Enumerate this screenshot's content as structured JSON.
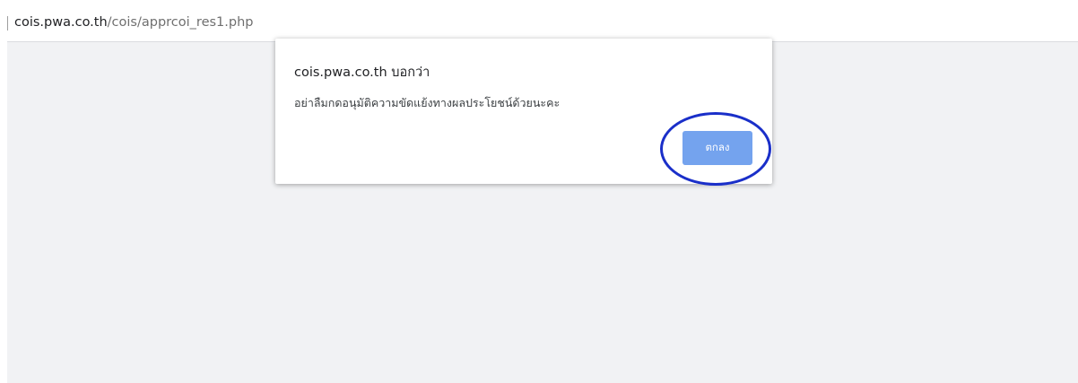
{
  "address_bar": {
    "host": "cois.pwa.co.th",
    "path": "/cois/apprcoi_res1.php"
  },
  "dialog": {
    "title": "cois.pwa.co.th บอกว่า",
    "message": "อย่าลืมกดอนุมัติความขัดแย้งทางผลประโยชน์ด้วยนะคะ",
    "ok_label": "ตกลง"
  },
  "colors": {
    "button": "#74a3ee",
    "highlight_ring": "#1a2fc9",
    "page_background": "#f1f2f4"
  }
}
